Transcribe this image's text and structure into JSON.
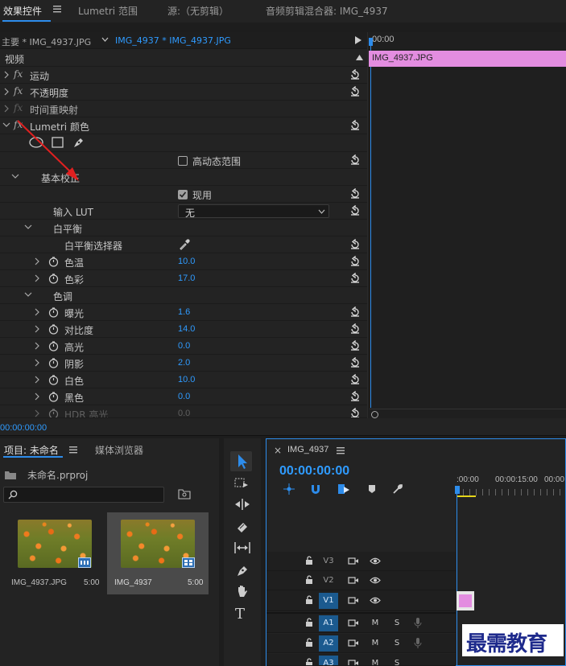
{
  "tabs": {
    "effect_controls": "效果控件",
    "lumetri_scopes": "Lumetri 范围",
    "source": "源:（无剪辑）",
    "audio_mixer": "音频剪辑混合器: IMG_4937"
  },
  "ec": {
    "master_tab": "主要 * IMG_4937.JPG",
    "seq_tab": "IMG_4937 * IMG_4937.JPG",
    "timecode_top": "00:00",
    "clip_name": "IMG_4937.JPG",
    "video_header": "视频",
    "motion": "运动",
    "opacity": "不透明度",
    "time_remap": "时间重映射",
    "lumetri": "Lumetri 颜色",
    "hdr_range": "高动态范围",
    "basic_correction": "基本校正",
    "apply_label": "现用",
    "input_lut": "输入 LUT",
    "input_lut_value": "无",
    "white_balance": "白平衡",
    "wb_selector": "白平衡选择器",
    "temperature": "色温",
    "temperature_value": "10.0",
    "tint": "色彩",
    "tint_value": "17.0",
    "tone": "色调",
    "exposure": "曝光",
    "exposure_value": "1.6",
    "contrast": "对比度",
    "contrast_value": "14.0",
    "highlights": "高光",
    "highlights_value": "0.0",
    "shadows": "阴影",
    "shadows_value": "2.0",
    "whites": "白色",
    "whites_value": "10.0",
    "blacks": "黑色",
    "blacks_value": "0.0",
    "hdr_highlight": "HDR 高光",
    "hdr_highlight_value": "0.0",
    "bottom_timecode": "00:00:00:00"
  },
  "project": {
    "tab_project": "项目: 未命名",
    "tab_media_browser": "媒体浏览器",
    "file_name": "未命名.prproj",
    "items": [
      {
        "name": "IMG_4937.JPG",
        "duration": "5:00"
      },
      {
        "name": "IMG_4937",
        "duration": "5:00"
      }
    ]
  },
  "timeline": {
    "sequence_name": "IMG_4937",
    "timecode": "00:00:00:00",
    "ruler": [
      ":00:00",
      "00:00:15:00",
      "00:00"
    ],
    "tracks_video": [
      "V3",
      "V2",
      "V1"
    ],
    "tracks_audio": [
      "A1",
      "A2",
      "A3"
    ],
    "m_label": "M",
    "s_label": "S"
  },
  "watermark": "最需教育",
  "colors": {
    "accent": "#2d8ceb",
    "value_blue": "#2f9bff",
    "clip_pink": "#e38de0"
  }
}
